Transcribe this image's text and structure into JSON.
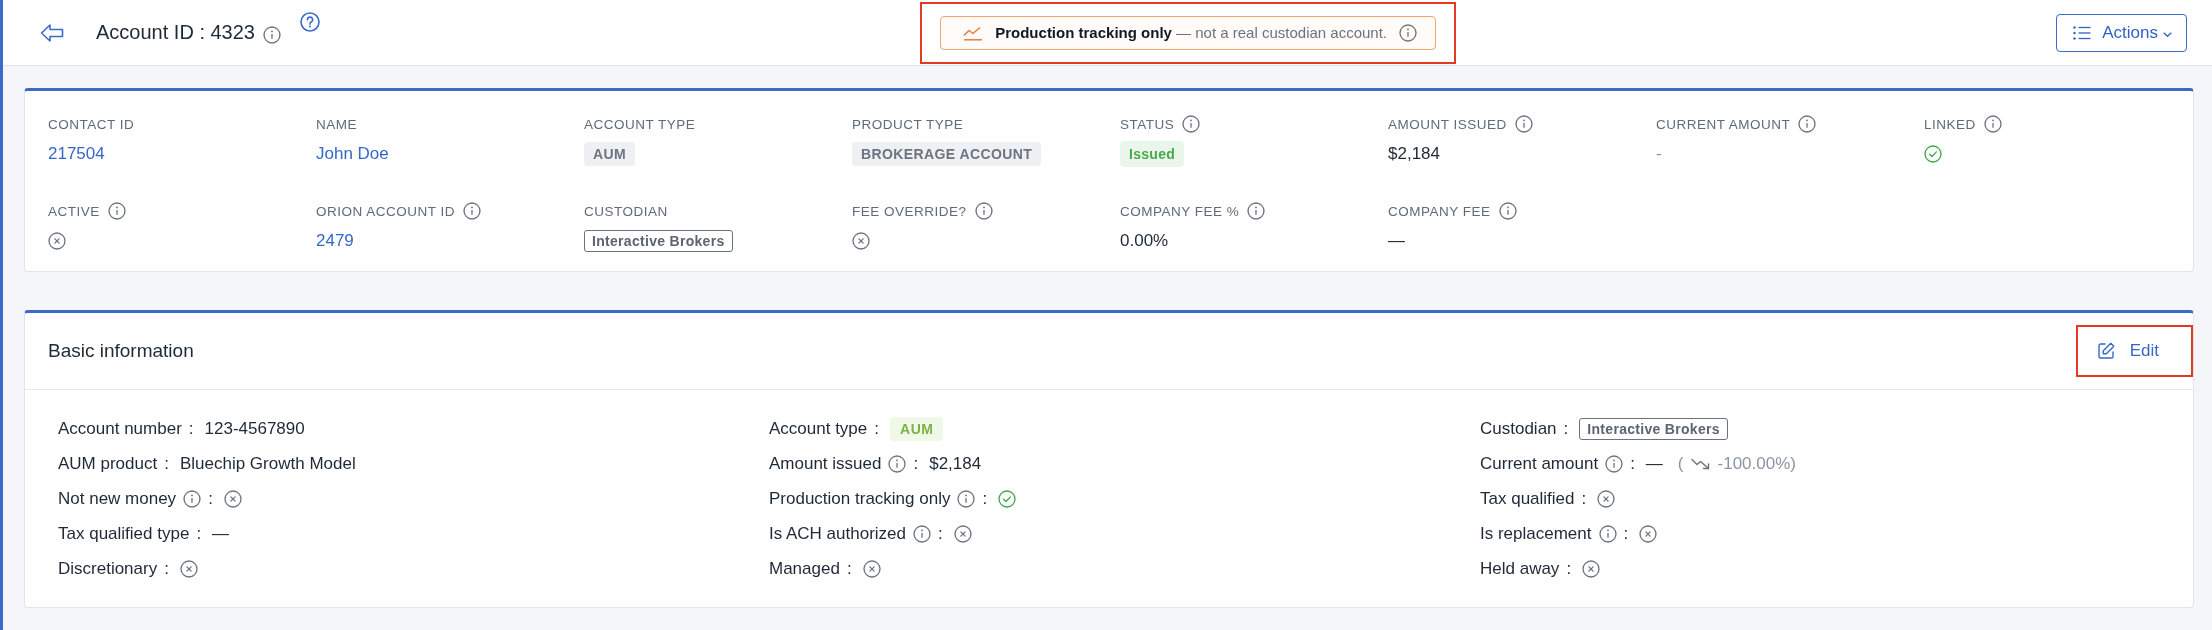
{
  "header": {
    "title": "Account ID : 4323"
  },
  "banner": {
    "highlighted": true,
    "text": "**Production tracking only** — not a real custodian account."
  },
  "actions_button": {
    "label": "Actions"
  },
  "summary": {
    "fields": [
      {
        "label": "CONTACT ID",
        "info": false,
        "kind": "link",
        "value": "217504"
      },
      {
        "label": "NAME",
        "info": false,
        "kind": "link",
        "value": "John Doe"
      },
      {
        "label": "ACCOUNT TYPE",
        "info": false,
        "kind": "tag",
        "value": "AUM"
      },
      {
        "label": "PRODUCT TYPE",
        "info": false,
        "kind": "tag",
        "value": "BROKERAGE ACCOUNT"
      },
      {
        "label": "STATUS",
        "info": true,
        "kind": "status",
        "value": "Issued"
      },
      {
        "label": "AMOUNT ISSUED",
        "info": true,
        "kind": "text",
        "value": "$2,184"
      },
      {
        "label": "CURRENT AMOUNT",
        "info": true,
        "kind": "muted",
        "value": "-"
      },
      {
        "label": "LINKED",
        "info": true,
        "kind": "bool",
        "checked": true
      },
      {
        "label": "ACTIVE",
        "info": true,
        "kind": "bool",
        "checked": false
      },
      {
        "label": "ORION ACCOUNT ID",
        "info": true,
        "kind": "link",
        "value": "2479"
      },
      {
        "label": "CUSTODIAN",
        "info": false,
        "kind": "outline",
        "value": "Interactive Brokers"
      },
      {
        "label": "FEE OVERRIDE?",
        "info": true,
        "kind": "bool",
        "checked": false
      },
      {
        "label": "COMPANY FEE %",
        "info": true,
        "kind": "text",
        "value": "0.00%"
      },
      {
        "label": "COMPANY FEE",
        "info": true,
        "kind": "text",
        "value": "—"
      }
    ]
  },
  "basic_information": {
    "title": "Basic information",
    "edit_button": {
      "label": "Edit",
      "highlighted": true
    },
    "columns": [
      {
        "rows": [
          {
            "label": "Account number",
            "info": false,
            "sep": ":",
            "kind": "text",
            "value": "123-4567890"
          },
          {
            "label": "AUM product",
            "info": false,
            "sep": ":",
            "kind": "text",
            "value": "Bluechip Growth Model"
          },
          {
            "label": "Not new money",
            "info": true,
            "sep": ":",
            "kind": "bool",
            "checked": false
          },
          {
            "label": "Tax qualified type",
            "info": false,
            "sep": ":",
            "kind": "text",
            "value": "—"
          },
          {
            "label": "Discretionary",
            "info": false,
            "sep": ":",
            "kind": "bool",
            "checked": false
          }
        ]
      },
      {
        "rows": [
          {
            "label": "Account type",
            "info": false,
            "sep": ":",
            "kind": "type",
            "value": "AUM"
          },
          {
            "label": "Amount issued",
            "info": true,
            "sep": ":",
            "kind": "text",
            "value": "$2,184"
          },
          {
            "label": "Production tracking only",
            "info": true,
            "sep": ":",
            "kind": "bool",
            "checked": true
          },
          {
            "label": "Is ACH authorized",
            "info": true,
            "sep": ":",
            "kind": "bool",
            "checked": false
          },
          {
            "label": "Managed",
            "info": false,
            "sep": ":",
            "kind": "bool",
            "checked": false
          }
        ]
      },
      {
        "rows": [
          {
            "label": "Custodian",
            "info": false,
            "sep": ":",
            "kind": "outline",
            "value": "Interactive Brokers"
          },
          {
            "label": "Current amount",
            "info": true,
            "sep": ":",
            "kind": "change",
            "value": "—",
            "delta_open": "(",
            "delta": "-100.00%)"
          },
          {
            "label": "Tax qualified",
            "info": false,
            "sep": ":",
            "kind": "bool",
            "checked": false
          },
          {
            "label": "Is replacement",
            "info": true,
            "sep": ":",
            "kind": "bool",
            "checked": false
          },
          {
            "label": "Held away",
            "info": false,
            "sep": ":",
            "kind": "bool",
            "checked": false
          }
        ]
      }
    ]
  }
}
